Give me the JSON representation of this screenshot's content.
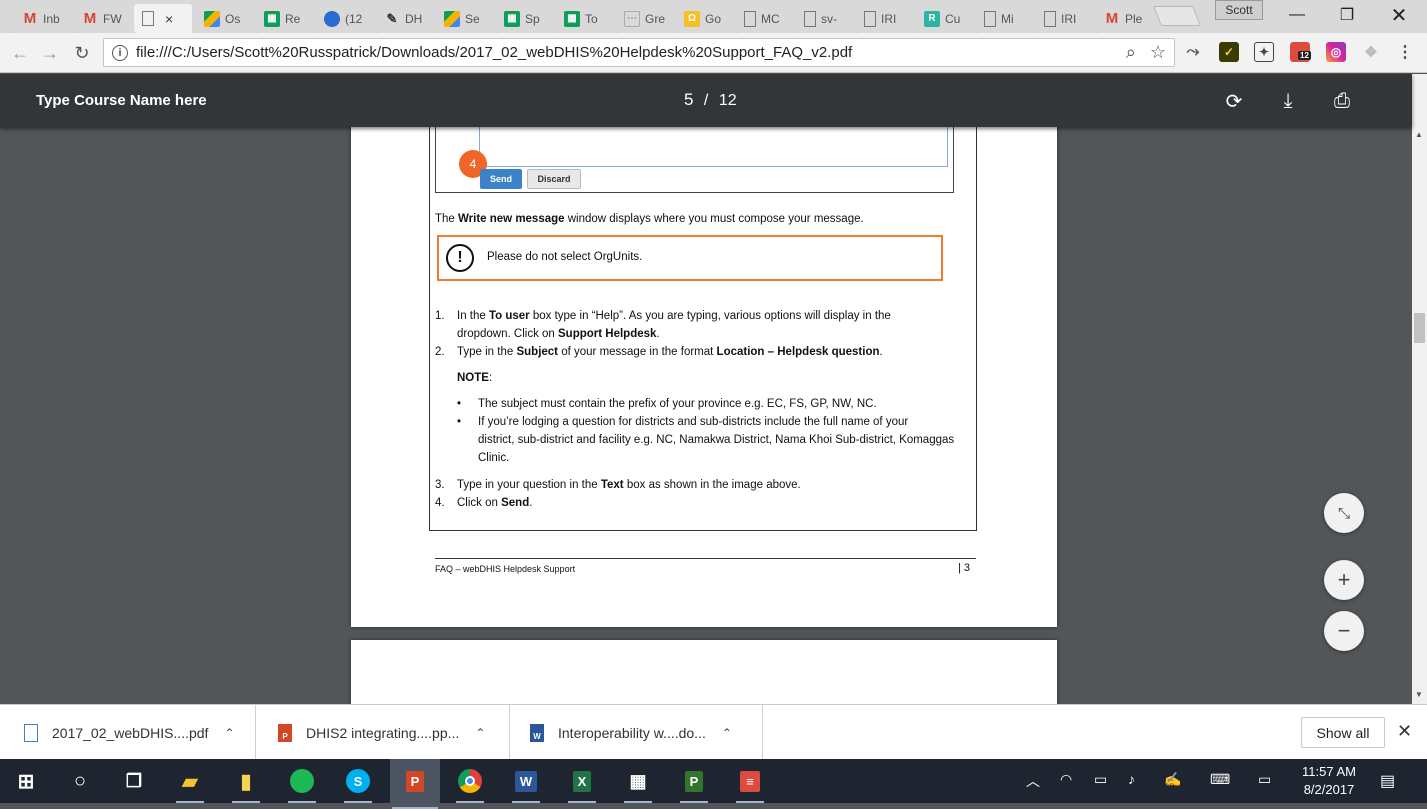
{
  "browser": {
    "tabs": [
      {
        "label": "Inb",
        "icon": "gmail-icon",
        "color": "#d44638"
      },
      {
        "label": "FW",
        "icon": "gmail-icon",
        "color": "#d44638"
      },
      {
        "label": "",
        "icon": "document-icon",
        "color": "#888888",
        "active": true
      },
      {
        "label": "Os",
        "icon": "google-drive-icon",
        "color": "#f4b400"
      },
      {
        "label": "Re",
        "icon": "sheets-icon",
        "color": "#0f9d58"
      },
      {
        "label": "(12",
        "icon": "cloud-icon",
        "color": "#2a6bd1"
      },
      {
        "label": "DH",
        "icon": "tool-icon",
        "color": "#333333"
      },
      {
        "label": "Se",
        "icon": "google-drive-icon",
        "color": "#f4b400"
      },
      {
        "label": "Sp",
        "icon": "sheets-icon",
        "color": "#0f9d58"
      },
      {
        "label": "To",
        "icon": "sheets-icon",
        "color": "#0f9d58"
      },
      {
        "label": "Gre",
        "icon": "grid-icon",
        "color": "#999999"
      },
      {
        "label": "Go",
        "icon": "keep-icon",
        "color": "#f6bf26"
      },
      {
        "label": "MC",
        "icon": "document-icon",
        "color": "#888888"
      },
      {
        "label": "sv-",
        "icon": "document-icon",
        "color": "#888888"
      },
      {
        "label": "IRI",
        "icon": "document-icon",
        "color": "#888888"
      },
      {
        "label": "Cu",
        "icon": "r-icon",
        "color": "#2bb3a3"
      },
      {
        "label": "Mi",
        "icon": "document-icon",
        "color": "#888888"
      },
      {
        "label": "IRI",
        "icon": "document-icon",
        "color": "#888888"
      },
      {
        "label": "Ple",
        "icon": "gmail-icon",
        "color": "#d44638"
      }
    ],
    "tab_close": "×",
    "profile_name": "Scott",
    "url": "file:///C:/Users/Scott%20Russpatrick/Downloads/2017_02_webDHIS%20Helpdesk%20Support_FAQ_v2.pdf",
    "extension_badge": "12"
  },
  "pdf": {
    "title": "Type Course Name here",
    "current_page": "5",
    "separator": "/",
    "total_pages": "12"
  },
  "document": {
    "badge_number": "4",
    "send_label": "Send",
    "discard_label": "Discard",
    "intro_pre": "The ",
    "intro_bold": "Write new message",
    "intro_post": " window displays where you must compose your message.",
    "warning_icon": "!",
    "warning_text": "Please do not select OrgUnits.",
    "step1_num": "1.",
    "step1_a": "In the ",
    "step1_b": "To user",
    "step1_c": " box type in “Help”. As you are typing, various options will display in the",
    "step1_d": "dropdown. Click on ",
    "step1_e": "Support Helpdesk",
    "step1_f": ".",
    "step2_num": "2.",
    "step2_a": "Type in the ",
    "step2_b": "Subject",
    "step2_c": " of your message in the format ",
    "step2_d": "Location – Helpdesk question",
    "step2_e": ".",
    "note_label": "NOTE",
    "note_colon": ":",
    "bullet1": "The subject must contain the prefix of your province e.g. EC, FS, GP, NW, NC.",
    "bullet2_l1": "If you’re lodging a question for districts and sub-districts include the full name of your",
    "bullet2_l2": "district, sub-district and facility e.g. NC, Namakwa District, Nama Khoi Sub-district, Komaggas",
    "bullet2_l3": "Clinic.",
    "step3_num": "3.",
    "step3_a": "Type in your question in the ",
    "step3_b": "Text",
    "step3_c": " box as shown in the image above.",
    "step4_num": "4.",
    "step4_a": "Click on ",
    "step4_b": "Send",
    "step4_c": ".",
    "footer_left": "FAQ – webDHIS Helpdesk Support",
    "footer_right": "| 3"
  },
  "downloads": {
    "items": [
      {
        "name": "2017_02_webDHIS....pdf",
        "icon": "pdf-file-icon"
      },
      {
        "name": "DHIS2 integrating....pp...",
        "icon": "powerpoint-file-icon"
      },
      {
        "name": "Interoperability w....do...",
        "icon": "word-file-icon"
      }
    ],
    "show_all": "Show all"
  },
  "taskbar": {
    "time": "11:57 AM",
    "date": "8/2/2017"
  },
  "colors": {
    "accent_orange": "#ef7c2e",
    "send_blue": "#3b82c8",
    "pdf_toolbar": "#323639",
    "viewer_bg": "#525659"
  }
}
